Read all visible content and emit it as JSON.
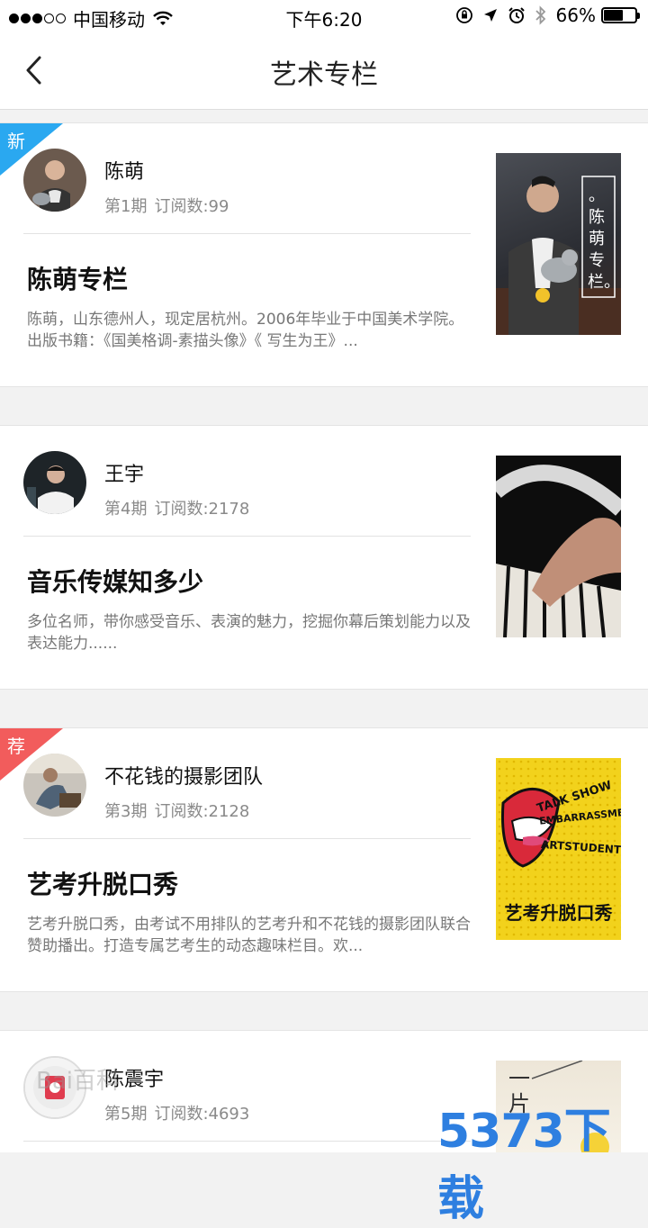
{
  "status_bar": {
    "carrier": "中国移动",
    "time": "下午6:20",
    "battery": "66%",
    "battery_level": 0.66
  },
  "nav": {
    "title": "艺术专栏"
  },
  "cards": [
    {
      "badge": "新",
      "author": "陈萌",
      "issue": "第1期",
      "subscribers": "订阅数:99",
      "title": "陈萌专栏",
      "description": "陈萌，山东德州人，现定居杭州。2006年毕业于中国美术学院。出版书籍：《国美格调-素描头像》《 写生为王》...",
      "thumb_text": "。陈萌专栏。"
    },
    {
      "badge": "",
      "author": "王宇",
      "issue": "第4期",
      "subscribers": "订阅数:2178",
      "title": "音乐传媒知多少",
      "description": "多位名师，带你感受音乐、表演的魅力，挖掘你幕后策划能力以及表达能力......",
      "thumb_text": ""
    },
    {
      "badge": "荐",
      "author": "不花钱的摄影团队",
      "issue": "第3期",
      "subscribers": "订阅数:2128",
      "title": "艺考升脱口秀",
      "description": "艺考升脱口秀，由考试不用排队的艺考升和不花钱的摄影团队联合赞助播出。打造专属艺考生的动态趣味栏目。欢...",
      "thumb_text": "艺考升脱口秀",
      "thumb_words": [
        "TALK SHOW",
        "EMBARRASSMENT",
        "ARTSTUDENT"
      ]
    },
    {
      "badge": "",
      "author": "陈震宇",
      "issue": "第5期",
      "subscribers": "订阅数:4693",
      "title": "",
      "description": "",
      "thumb_text": "一片"
    }
  ],
  "watermarks": {
    "brand": "5373下载",
    "baidu": "Bai百科"
  }
}
